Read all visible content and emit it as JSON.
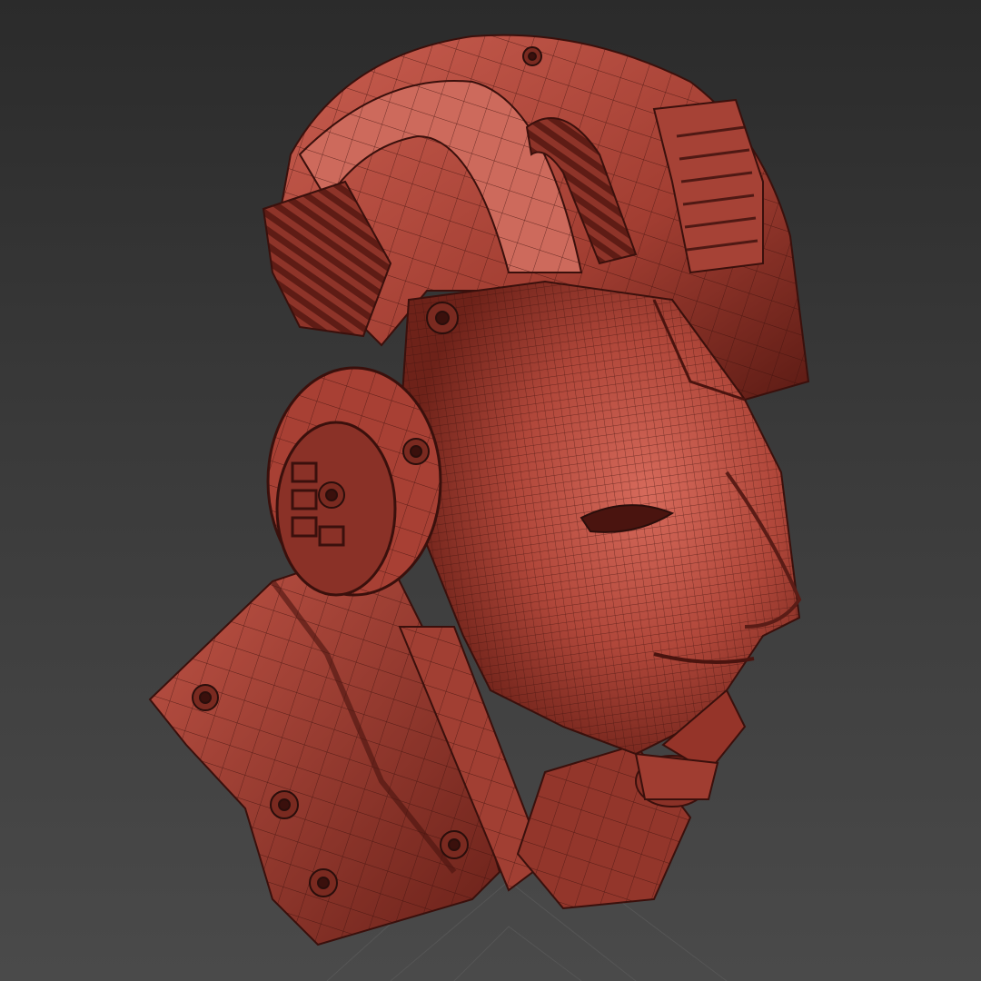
{
  "viewport": {
    "background_top": "#2b2b2b",
    "background_bottom": "#4a4a4a",
    "grid_color": "#5a5a5a"
  },
  "model": {
    "subject": "robot-head-wireframe",
    "shading_color": "#b04a3c",
    "highlight_color": "#d9776a",
    "shadow_color": "#5a1c16",
    "wire_color": "#2a0e0b"
  }
}
